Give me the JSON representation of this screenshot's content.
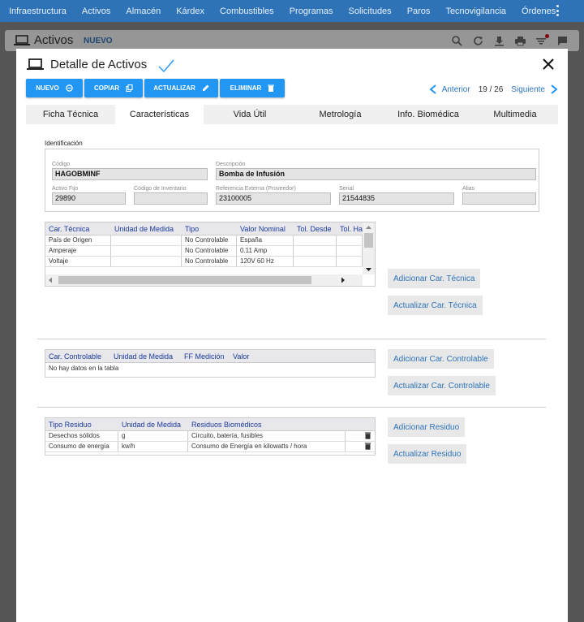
{
  "topnav": [
    "Infraestructura",
    "Activos",
    "Almacén",
    "Kárdex",
    "Combustibles",
    "Programas",
    "Solicitudes",
    "Paros",
    "Tecnovigilancia",
    "Órdenes"
  ],
  "page": {
    "title": "Activos",
    "badge": "NUEVO"
  },
  "modal": {
    "title": "Detalle de Activos",
    "buttons": {
      "nuevo": "NUEVO",
      "copiar": "COPIAR",
      "actualizar": "ACTUALIZAR",
      "eliminar": "ELIMINAR"
    },
    "pager": {
      "prev": "Anterior",
      "count": "19 / 26",
      "next": "Siguiente"
    },
    "tabs": [
      "Ficha Técnica",
      "Características",
      "Vida Útil",
      "Metrología",
      "Info. Biomédica",
      "Multimedia"
    ],
    "active_tab": "Características"
  },
  "identificacion": {
    "section_label": "Identificación",
    "codigo": {
      "label": "Código",
      "value": "HAGOBMINF"
    },
    "descripcion": {
      "label": "Descripción",
      "value": "Bomba de Infusión"
    },
    "activo_fijo": {
      "label": "Activo Fijo",
      "value": "29890"
    },
    "codigo_inventario": {
      "label": "Código de Inventario",
      "value": ""
    },
    "referencia_externa": {
      "label": "Referencia Externa (Proveedor)",
      "value": "23100005"
    },
    "serial": {
      "label": "Serial",
      "value": "21544835"
    },
    "alias": {
      "label": "Alias",
      "value": ""
    }
  },
  "car_tecnica": {
    "headers": [
      "Car. Técnica",
      "Unidad de Medida",
      "Tipo",
      "Valor Nominal",
      "Tol. Desde",
      "Tol. Ha"
    ],
    "rows": [
      [
        "País de Origen",
        "",
        "No Controlable",
        "España",
        "",
        ""
      ],
      [
        "Amperaje",
        "",
        "No Controlable",
        "0.11 Amp",
        "",
        ""
      ],
      [
        "Voltaje",
        "",
        "No Controlable",
        "120V 60 Hz",
        "",
        ""
      ]
    ],
    "btn_add": "Adicionar Car. Técnica",
    "btn_update": "Actualizar Car. Técnica"
  },
  "car_controlable": {
    "headers": [
      "Car. Controlable",
      "Unidad de Medida",
      "FF Medición",
      "Valor"
    ],
    "empty": "No hay datos en la tabla",
    "btn_add": "Adicionar Car. Controlable",
    "btn_update": "Actualizar Car. Controlable"
  },
  "residuos": {
    "headers": [
      "Tipo Residuo",
      "Unidad de Medida",
      "Residuos Biomédicos"
    ],
    "rows": [
      [
        "Desechos sólidos",
        "g",
        "Circuito, batería, fusibles"
      ],
      [
        "Consumo de energía",
        "kw/h",
        "Consumo de Energía en kilowatts / hora"
      ]
    ],
    "btn_add": "Adicionar Residuo",
    "btn_update": "Actualizar Residuo"
  },
  "colors": {
    "primary": "#2196f3",
    "nav": "#2e73b8",
    "header_text": "#1a3a9a"
  }
}
